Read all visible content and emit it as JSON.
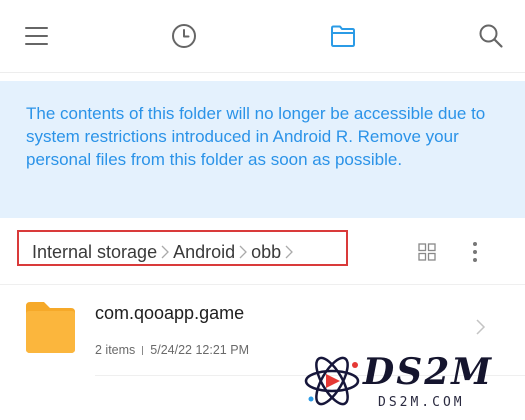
{
  "toolbar": {
    "menu_icon": "hamburger-menu-icon",
    "recent_icon": "clock-icon",
    "folder_icon": "folder-icon",
    "search_icon": "search-icon",
    "accent_color": "#2b9be6"
  },
  "notice": {
    "text": "The contents of this folder will no longer be accessible due to system restrictions introduced in Android R. Remove your personal files from this folder as soon as possible.",
    "background_color": "#e4f1fd",
    "text_color": "#2b93e8"
  },
  "breadcrumb": {
    "items": [
      "Internal storage",
      "Android",
      "obb"
    ],
    "highlight_color": "#d93a3a"
  },
  "view_controls": {
    "grid_icon": "grid-view-icon",
    "more_icon": "more-vertical-icon"
  },
  "files": [
    {
      "name": "com.qooapp.game",
      "item_count": "2 items",
      "modified": "5/24/22 12:21 PM",
      "icon": "folder-icon",
      "icon_color": "#fbb33a"
    }
  ],
  "watermark": {
    "logo_text": "DS2M",
    "url": "DS2M.COM"
  }
}
